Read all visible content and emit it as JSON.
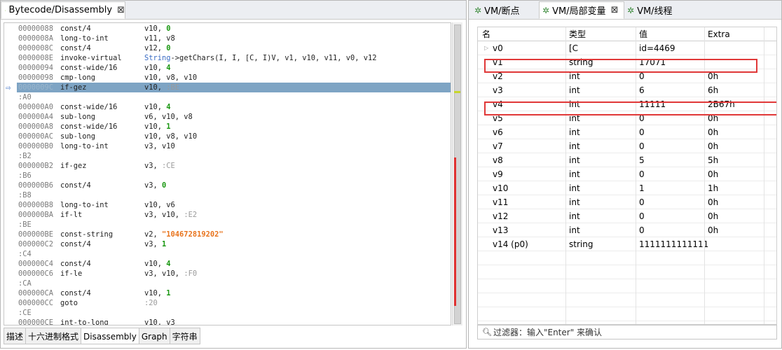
{
  "left_tab": {
    "title": "Bytecode/Disassembly",
    "close": "⊠"
  },
  "code_lines": [
    {
      "kind": "instr",
      "addr": "00000088",
      "op": "const/4",
      "args": [
        {
          "t": "v10, "
        },
        {
          "t": "0",
          "c": "num"
        }
      ]
    },
    {
      "kind": "instr",
      "addr": "0000008A",
      "op": "long-to-int",
      "args": [
        {
          "t": "v11, v8"
        }
      ]
    },
    {
      "kind": "instr",
      "addr": "0000008C",
      "op": "const/4",
      "args": [
        {
          "t": "v12, "
        },
        {
          "t": "0",
          "c": "num"
        }
      ]
    },
    {
      "kind": "instr",
      "addr": "0000008E",
      "op": "invoke-virtual",
      "args": [
        {
          "t": "String",
          "c": "cls"
        },
        {
          "t": "->getChars(I, I, [C, I)V, v1, v10, v11, v0, v12"
        }
      ]
    },
    {
      "kind": "instr",
      "addr": "00000094",
      "op": "const-wide/16",
      "args": [
        {
          "t": "v10, "
        },
        {
          "t": "4",
          "c": "num"
        }
      ]
    },
    {
      "kind": "instr",
      "addr": "00000098",
      "op": "cmp-long",
      "args": [
        {
          "t": "v10, v8, v10"
        }
      ]
    },
    {
      "kind": "instr",
      "addr": "0000009C",
      "op": "if-gez",
      "args": [
        {
          "t": "v10, "
        },
        {
          "t": ":BE",
          "c": "lbl-ref"
        }
      ],
      "highlight": true,
      "arrow": "⇨"
    },
    {
      "kind": "label",
      "text": ":A0"
    },
    {
      "kind": "instr",
      "addr": "000000A0",
      "op": "const-wide/16",
      "args": [
        {
          "t": "v10, "
        },
        {
          "t": "4",
          "c": "num"
        }
      ]
    },
    {
      "kind": "instr",
      "addr": "000000A4",
      "op": "sub-long",
      "args": [
        {
          "t": "v6, v10, v8"
        }
      ]
    },
    {
      "kind": "instr",
      "addr": "000000A8",
      "op": "const-wide/16",
      "args": [
        {
          "t": "v10, "
        },
        {
          "t": "1",
          "c": "num"
        }
      ]
    },
    {
      "kind": "instr",
      "addr": "000000AC",
      "op": "sub-long",
      "args": [
        {
          "t": "v10, v8, v10"
        }
      ]
    },
    {
      "kind": "instr",
      "addr": "000000B0",
      "op": "long-to-int",
      "args": [
        {
          "t": "v3, v10"
        }
      ]
    },
    {
      "kind": "label",
      "text": ":B2"
    },
    {
      "kind": "instr",
      "addr": "000000B2",
      "op": "if-gez",
      "args": [
        {
          "t": "v3, "
        },
        {
          "t": ":CE",
          "c": "lbl-ref"
        }
      ]
    },
    {
      "kind": "label",
      "text": ":B6"
    },
    {
      "kind": "instr",
      "addr": "000000B6",
      "op": "const/4",
      "args": [
        {
          "t": "v3, "
        },
        {
          "t": "0",
          "c": "num"
        }
      ]
    },
    {
      "kind": "label",
      "text": ":B8"
    },
    {
      "kind": "instr",
      "addr": "000000B8",
      "op": "long-to-int",
      "args": [
        {
          "t": "v10, v6"
        }
      ]
    },
    {
      "kind": "instr",
      "addr": "000000BA",
      "op": "if-lt",
      "args": [
        {
          "t": "v3, v10, "
        },
        {
          "t": ":E2",
          "c": "lbl-ref"
        }
      ]
    },
    {
      "kind": "label",
      "text": ":BE"
    },
    {
      "kind": "instr",
      "addr": "000000BE",
      "op": "const-string",
      "args": [
        {
          "t": "v2, "
        },
        {
          "t": "\"104672819202\"",
          "c": "str"
        }
      ]
    },
    {
      "kind": "instr",
      "addr": "000000C2",
      "op": "const/4",
      "args": [
        {
          "t": "v3, "
        },
        {
          "t": "1",
          "c": "num"
        }
      ]
    },
    {
      "kind": "label",
      "text": ":C4"
    },
    {
      "kind": "instr",
      "addr": "000000C4",
      "op": "const/4",
      "args": [
        {
          "t": "v10, "
        },
        {
          "t": "4",
          "c": "num"
        }
      ]
    },
    {
      "kind": "instr",
      "addr": "000000C6",
      "op": "if-le",
      "args": [
        {
          "t": "v3, v10, "
        },
        {
          "t": ":F0",
          "c": "lbl-ref"
        }
      ]
    },
    {
      "kind": "label",
      "text": ":CA"
    },
    {
      "kind": "instr",
      "addr": "000000CA",
      "op": "const/4",
      "args": [
        {
          "t": "v10, "
        },
        {
          "t": "1",
          "c": "num"
        }
      ]
    },
    {
      "kind": "instr",
      "addr": "000000CC",
      "op": "goto",
      "args": [
        {
          "t": ":20",
          "c": "lbl-ref"
        }
      ]
    },
    {
      "kind": "label",
      "text": ":CE"
    },
    {
      "kind": "instr",
      "addr": "000000CE",
      "op": "int-to-long",
      "args": [
        {
          "t": "v10, v3"
        }
      ]
    }
  ],
  "bottom_tabs": [
    "描述",
    "十六进制格式",
    "Disassembly",
    "Graph",
    "字符串"
  ],
  "active_bottom_tab": "Disassembly",
  "right_tabs": [
    {
      "label": "VM/断点",
      "icon": "bug-icon"
    },
    {
      "label": "VM/局部变量",
      "icon": "bug-icon",
      "active": true,
      "close": "⊠"
    },
    {
      "label": "VM/线程",
      "icon": "bug-icon"
    }
  ],
  "var_columns": {
    "name": "名",
    "type": "类型",
    "value": "值",
    "extra": "Extra"
  },
  "variables": [
    {
      "name": "v0",
      "type": "[C",
      "value": "id=4469",
      "extra": "",
      "expandable": true
    },
    {
      "name": "v1",
      "type": "string",
      "value": "17071",
      "extra": "",
      "boxed": true
    },
    {
      "name": "v2",
      "type": "int",
      "value": "0",
      "extra": "0h"
    },
    {
      "name": "v3",
      "type": "int",
      "value": "6",
      "extra": "6h"
    },
    {
      "name": "v4",
      "type": "int",
      "value": "11111",
      "extra": "2B67h",
      "boxed": true
    },
    {
      "name": "v5",
      "type": "int",
      "value": "0",
      "extra": "0h"
    },
    {
      "name": "v6",
      "type": "int",
      "value": "0",
      "extra": "0h"
    },
    {
      "name": "v7",
      "type": "int",
      "value": "0",
      "extra": "0h"
    },
    {
      "name": "v8",
      "type": "int",
      "value": "5",
      "extra": "5h"
    },
    {
      "name": "v9",
      "type": "int",
      "value": "0",
      "extra": "0h"
    },
    {
      "name": "v10",
      "type": "int",
      "value": "1",
      "extra": "1h"
    },
    {
      "name": "v11",
      "type": "int",
      "value": "0",
      "extra": "0h"
    },
    {
      "name": "v12",
      "type": "int",
      "value": "0",
      "extra": "0h"
    },
    {
      "name": "v13",
      "type": "int",
      "value": "0",
      "extra": "0h"
    },
    {
      "name": "v14 (p0)",
      "type": "string",
      "value": "1111111111111",
      "extra": ""
    }
  ],
  "filter": {
    "placeholder": "过滤器：输入\"Enter\" 来确认",
    "icon": "search-icon"
  }
}
